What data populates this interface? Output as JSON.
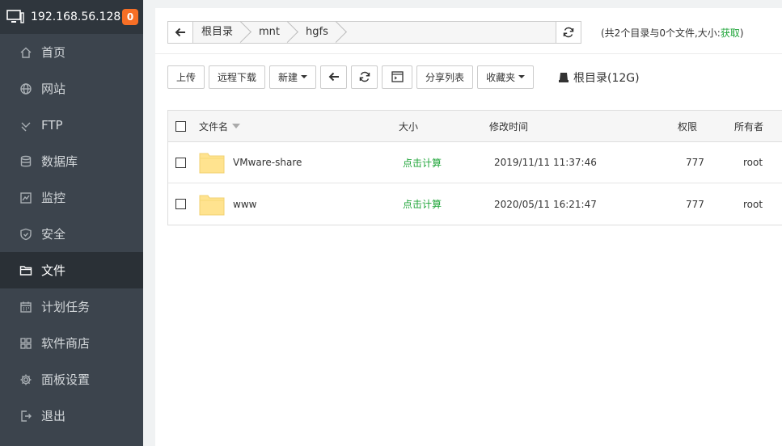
{
  "server": {
    "ip": "192.168.56.128",
    "badge": "0"
  },
  "sidebar": {
    "items": [
      {
        "label": "首页",
        "icon": "home-icon"
      },
      {
        "label": "网站",
        "icon": "globe-icon"
      },
      {
        "label": "FTP",
        "icon": "ftp-icon"
      },
      {
        "label": "数据库",
        "icon": "database-icon"
      },
      {
        "label": "监控",
        "icon": "monitor-icon"
      },
      {
        "label": "安全",
        "icon": "shield-icon"
      },
      {
        "label": "文件",
        "icon": "folder-icon",
        "active": true
      },
      {
        "label": "计划任务",
        "icon": "calendar-icon"
      },
      {
        "label": "软件商店",
        "icon": "apps-icon"
      },
      {
        "label": "面板设置",
        "icon": "gear-icon"
      },
      {
        "label": "退出",
        "icon": "logout-icon"
      }
    ]
  },
  "path": {
    "crumbs": [
      "根目录",
      "mnt",
      "hgfs"
    ],
    "info_prefix": "(共2个目录与0个文件,大小:",
    "info_link": "获取",
    "info_suffix": ")"
  },
  "toolbar": {
    "upload": "上传",
    "remote_download": "远程下载",
    "new": "新建",
    "share_list": "分享列表",
    "favorites": "收藏夹",
    "disk": "根目录(12G)"
  },
  "table": {
    "headers": {
      "name": "文件名",
      "size": "大小",
      "mtime": "修改时间",
      "perm": "权限",
      "owner": "所有者"
    },
    "rows": [
      {
        "name": "VMware-share",
        "size": "点击计算",
        "mtime": "2019/11/11 11:37:46",
        "perm": "777",
        "owner": "root"
      },
      {
        "name": "www",
        "size": "点击计算",
        "mtime": "2020/05/11 16:21:47",
        "perm": "777",
        "owner": "root"
      }
    ]
  },
  "colors": {
    "accent": "#20a53a",
    "sidebar_bg": "#3c444d",
    "badge": "#f76f26",
    "folder": "#ffe38f"
  }
}
